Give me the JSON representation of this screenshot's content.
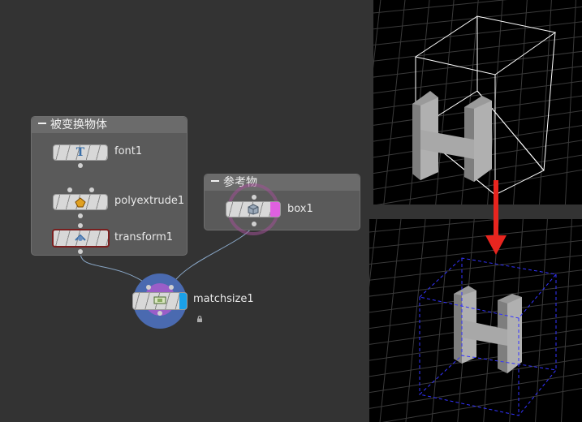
{
  "network": {
    "group1": {
      "title": "被变换物体"
    },
    "group2": {
      "title": "参考物"
    },
    "nodes": {
      "font": {
        "name": "font1",
        "icon": "font-icon"
      },
      "polyextrude": {
        "name": "polyextrude1",
        "icon": "polyextrude-icon"
      },
      "transform": {
        "name": "transform1",
        "icon": "transform-icon"
      },
      "box": {
        "name": "box1",
        "icon": "box-icon"
      },
      "matchsize": {
        "name": "matchsize1",
        "icon": "matchsize-icon",
        "flag": "lock-icon"
      }
    }
  },
  "viewports": {
    "top": {
      "wire_color": "#ffffff",
      "style": "solid"
    },
    "bottom": {
      "wire_color": "#3333ff",
      "style": "dashed"
    },
    "arrow_color": "#e8251f"
  }
}
